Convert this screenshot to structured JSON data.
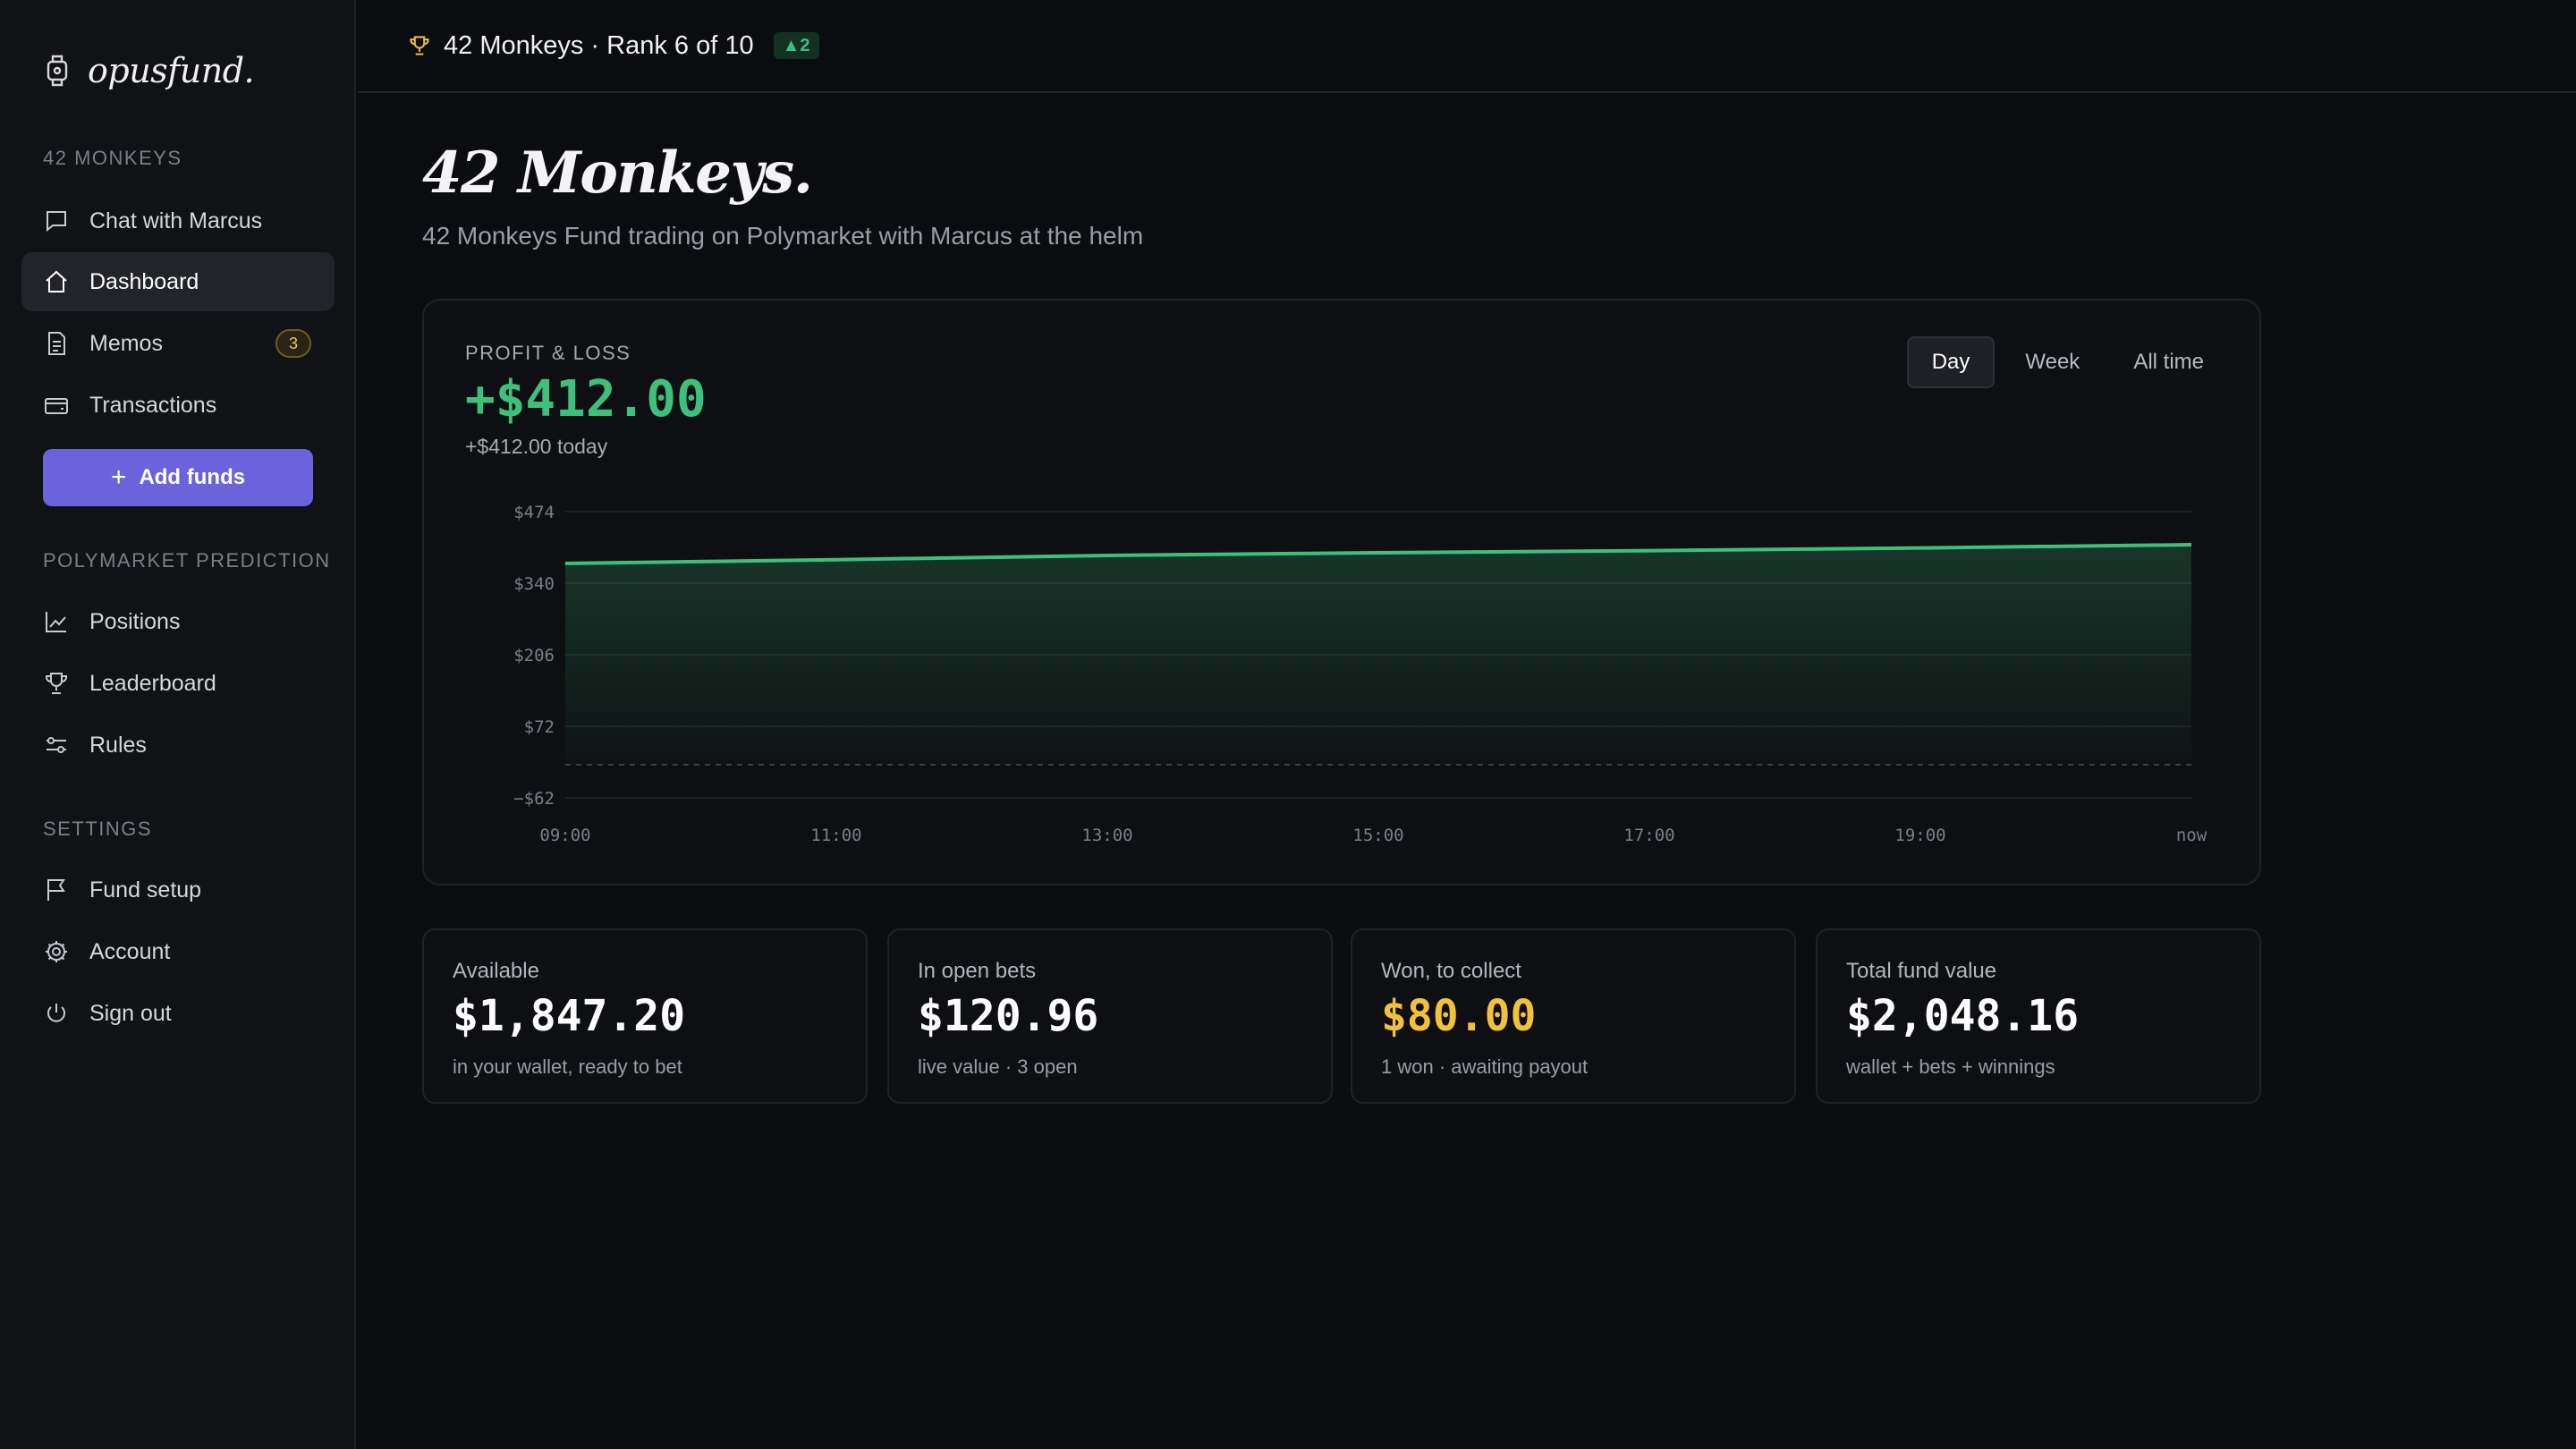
{
  "app": {
    "logo_text": "opusfund."
  },
  "sidebar": {
    "fund_section": "42 MONKEYS",
    "fund_items": [
      {
        "label": "Chat with Marcus",
        "icon": "chat-icon"
      },
      {
        "label": "Dashboard",
        "icon": "home-icon",
        "active": true
      },
      {
        "label": "Memos",
        "icon": "document-icon",
        "badge": "3"
      },
      {
        "label": "Transactions",
        "icon": "wallet-icon"
      }
    ],
    "add_funds_label": "Add funds",
    "polymarket_section": "POLYMARKET PREDICTION",
    "polymarket_items": [
      {
        "label": "Positions",
        "icon": "chart-line-icon"
      },
      {
        "label": "Leaderboard",
        "icon": "trophy-icon"
      },
      {
        "label": "Rules",
        "icon": "sliders-icon"
      }
    ],
    "settings_section": "SETTINGS",
    "settings_items": [
      {
        "label": "Fund setup",
        "icon": "flag-icon"
      },
      {
        "label": "Account",
        "icon": "gear-icon"
      },
      {
        "label": "Sign out",
        "icon": "power-icon"
      }
    ]
  },
  "topbar": {
    "title": "42 Monkeys · Rank 6 of 10",
    "rank_change": "▲2"
  },
  "main": {
    "title": "42 Monkeys.",
    "subtitle": "42 Monkeys Fund trading on Polymarket with Marcus at the helm"
  },
  "pnl": {
    "label": "PROFIT & LOSS",
    "value": "+$412.00",
    "today": "+$412.00 today",
    "periods": [
      "Day",
      "Week",
      "All time"
    ],
    "active_period": "Day"
  },
  "chart_data": {
    "type": "area",
    "x": [
      "09:00",
      "11:00",
      "13:00",
      "15:00",
      "17:00",
      "19:00",
      "now"
    ],
    "values": [
      377,
      384,
      392,
      397,
      401,
      406,
      412
    ],
    "y_ticks": [
      "$474",
      "$340",
      "$206",
      "$72",
      "−$62"
    ],
    "ylim": [
      -62,
      474
    ],
    "baseline": 0,
    "grid": true,
    "color": "#3ec07d"
  },
  "stats": [
    {
      "label": "Available",
      "value": "$1,847.20",
      "note": "in your wallet, ready to bet"
    },
    {
      "label": "In open bets",
      "value": "$120.96",
      "note": "live value · 3 open"
    },
    {
      "label": "Won, to collect",
      "value": "$80.00",
      "note": "1 won · awaiting payout",
      "color": "#f2c13c"
    },
    {
      "label": "Total fund value",
      "value": "$2,048.16",
      "note": "wallet + bets + winnings"
    }
  ]
}
